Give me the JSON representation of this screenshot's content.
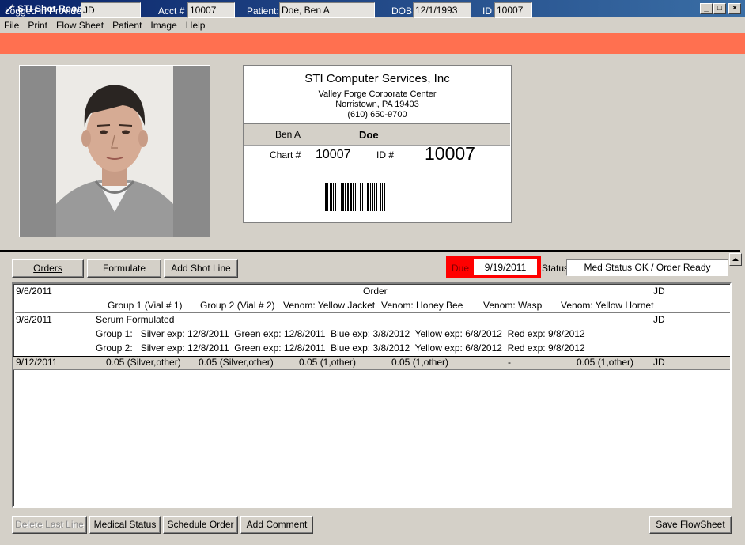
{
  "window": {
    "title": "STI Shot Room Automation"
  },
  "menu": [
    "File",
    "Print",
    "Flow Sheet",
    "Patient",
    "Image",
    "Help"
  ],
  "infobar": {
    "provider_label": "Logged in Provider:",
    "provider_value": "JD",
    "acct_label": "Acct #",
    "acct_value": "10007",
    "patient_label": "Patient:",
    "patient_value": "Doe, Ben A",
    "dob_label": "DOB",
    "dob_value": "12/1/1993",
    "id_label": "ID",
    "id_value": "10007"
  },
  "card": {
    "company": "STI Computer Services, Inc",
    "address1": "Valley Forge Corporate Center",
    "address2": "Norristown, PA 19403",
    "phone": "(610) 650-9700",
    "first_name": "Ben A",
    "last_name": "Doe",
    "chart_label": "Chart #",
    "chart_value": "10007",
    "id_label": "ID #",
    "id_value": "10007"
  },
  "toolbar": {
    "orders": "Orders",
    "formulate": "Formulate",
    "add_shot_line": "Add Shot Line",
    "due_label": "Due",
    "due_value": "9/19/2011",
    "status_label": "Status",
    "status_value": "Med Status OK / Order Ready"
  },
  "grid": {
    "order_row": {
      "date": "9/6/2011",
      "title": "Order",
      "provider": "JD"
    },
    "headers": [
      "Group 1 (Vial # 1)",
      "Group 2 (Vial # 2)",
      "Venom: Yellow Jacket",
      "Venom: Honey Bee",
      "Venom: Wasp",
      "Venom: Yellow Hornet"
    ],
    "serum_row": {
      "date": "9/8/2011",
      "title": "Serum Formulated",
      "provider": "JD",
      "group1": "Group 1:   Silver exp: 12/8/2011  Green exp: 12/8/2011  Blue exp: 3/8/2012  Yellow exp: 6/8/2012  Red exp: 9/8/2012",
      "group2": "Group 2:   Silver exp: 12/8/2011  Green exp: 12/8/2011  Blue exp: 3/8/2012  Yellow exp: 6/8/2012  Red exp: 9/8/2012"
    },
    "shot_row": {
      "date": "9/12/2011",
      "values": [
        "0.05 (Silver,other)",
        "0.05 (Silver,other)",
        "0.05 (1,other)",
        "0.05 (1,other)",
        "-",
        "0.05 (1,other)"
      ],
      "provider": "JD"
    }
  },
  "bottom": {
    "delete_last_line": "Delete Last Line",
    "medical_status": "Medical Status",
    "schedule_order": "Schedule Order",
    "add_comment": "Add Comment",
    "save_flowsheet": "Save FlowSheet"
  }
}
